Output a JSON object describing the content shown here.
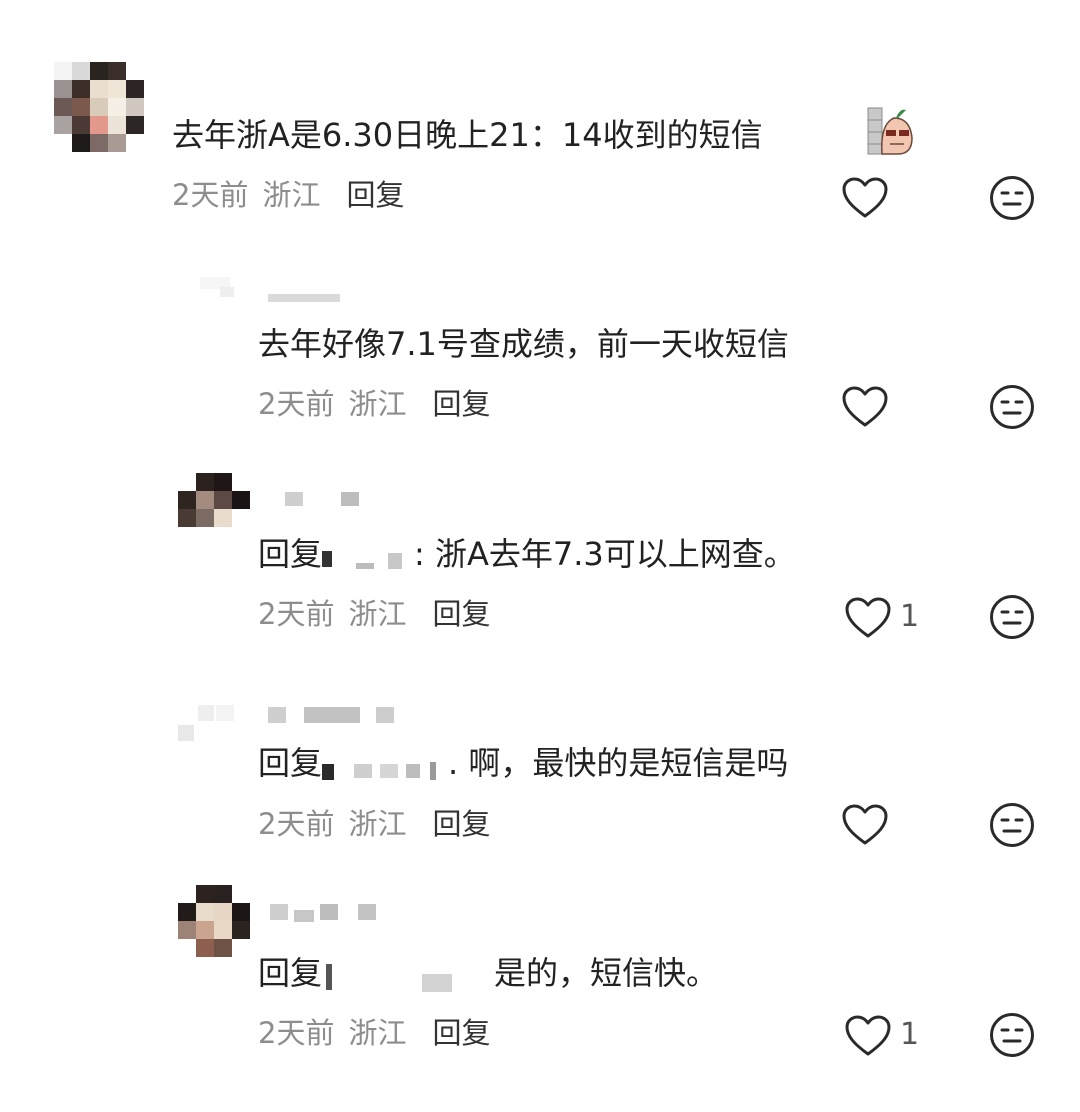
{
  "comments": [
    {
      "id": "c1",
      "text": "去年浙A是6.30日晚上21：14收到的短信",
      "time": "2天前",
      "location": "浙江",
      "reply_label": "回复",
      "likes": "",
      "has_sticker": true
    },
    {
      "id": "c2",
      "text": "去年好像7.1号查成绩，前一天收短信",
      "time": "2天前",
      "location": "浙江",
      "reply_label": "回复",
      "likes": ""
    },
    {
      "id": "c3",
      "reply_prefix": "回复",
      "text": ": 浙A去年7.3可以上网查。",
      "time": "2天前",
      "location": "浙江",
      "reply_label": "回复",
      "likes": "1"
    },
    {
      "id": "c4",
      "reply_prefix": "回复",
      "text": ". 啊，最快的是短信是吗",
      "time": "2天前",
      "location": "浙江",
      "reply_label": "回复",
      "likes": ""
    },
    {
      "id": "c5",
      "reply_prefix": "回复",
      "text": "是的，短信快。",
      "time": "2天前",
      "location": "浙江",
      "reply_label": "回复",
      "likes": "1"
    }
  ],
  "icons": {
    "like": "heart-outline-icon",
    "emoji": "neutral-face-icon",
    "sticker": "cartoon-peach-sticker"
  },
  "colors": {
    "text": "#222222",
    "meta": "#8d8d8d",
    "icon": "#2a2a2a"
  }
}
